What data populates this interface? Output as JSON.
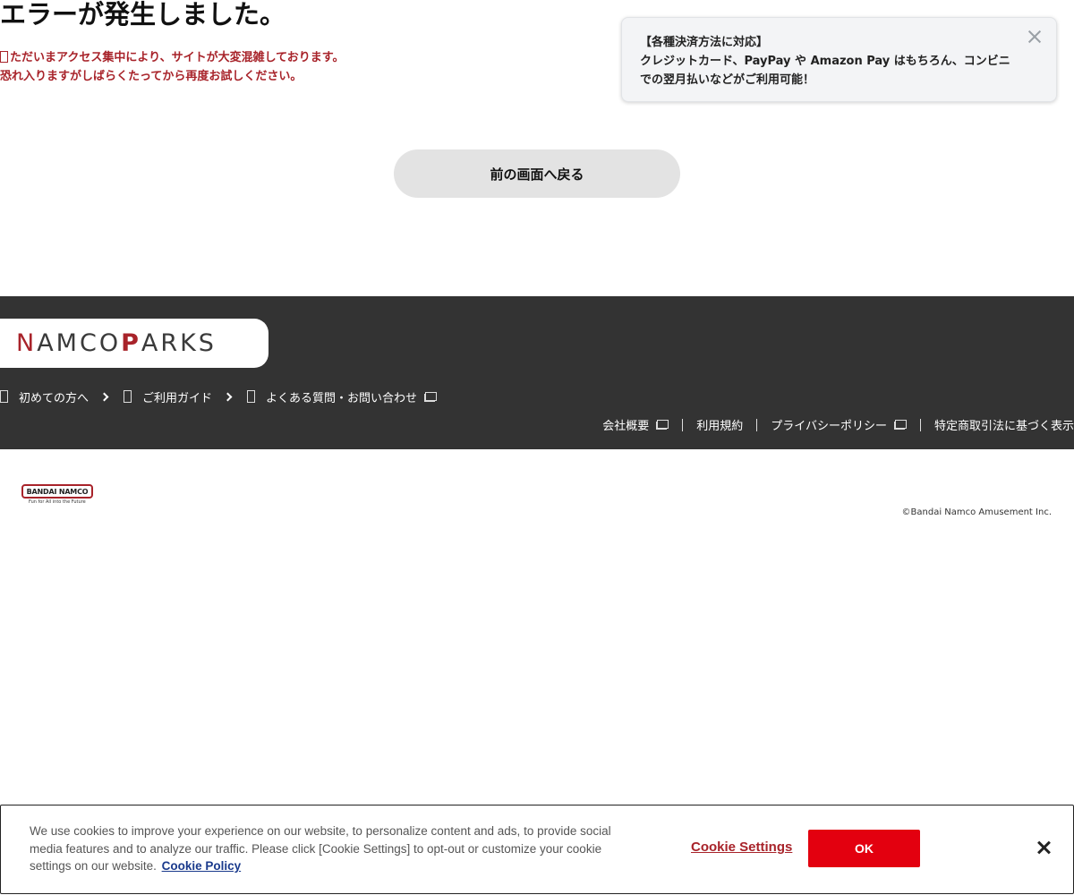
{
  "error": {
    "title": "エラーが発生しました。",
    "message_line1": "ただいまアクセス集中により、サイトが大変混雑しております。",
    "message_line2": "恐れ入りますがしばらくたってから再度お試しください。"
  },
  "notice": {
    "title": "【各種決済方法に対応】",
    "body": "クレジットカード、PayPay や Amazon Pay はもちろん、コンビニでの翌月払いなどがご利用可能！"
  },
  "back_button": {
    "label": "前の画面へ戻る"
  },
  "footer": {
    "logo": {
      "n": "N",
      "amco": "AMCO",
      "p": "P",
      "arks": "ARKS"
    },
    "nav": [
      {
        "label": "初めての方へ"
      },
      {
        "label": "ご利用ガイド"
      },
      {
        "label": "よくある質問・お問い合わせ"
      }
    ],
    "links": [
      {
        "label": "会社概要"
      },
      {
        "label": "利用規約"
      },
      {
        "label": "プライバシーポリシー"
      },
      {
        "label": "特定商取引法に基づく表示"
      }
    ]
  },
  "brand": {
    "logo_text": "BANDAI NAMCO",
    "tagline": "Fun for All into the Future",
    "copyright": "©Bandai Namco Amusement Inc."
  },
  "cookie": {
    "text": "We use cookies to improve your experience on our website, to personalize content and ads, to provide social media features and to analyze our traffic. Please click [Cookie Settings] to opt-out or customize your cookie settings on our website.",
    "policy_label": "Cookie Policy",
    "settings_label": "Cookie Settings",
    "ok_label": "OK"
  },
  "colors": {
    "accent_red": "#a8232a",
    "ok_red": "#e3000f",
    "footer_bg": "#333333"
  }
}
